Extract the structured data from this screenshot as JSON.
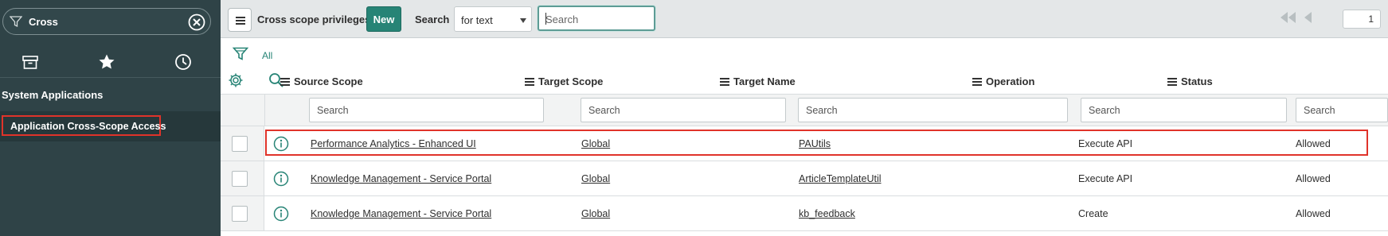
{
  "nav": {
    "filter_value": "Cross",
    "tabs": [
      "archive-icon",
      "star-icon",
      "clock-icon"
    ],
    "section_title": "System Applications",
    "module_label": "Application Cross-Scope Access"
  },
  "header": {
    "title": "Cross scope privileges",
    "new_label": "New",
    "search_label": "Search",
    "search_type": "for text",
    "search_placeholder": "Search",
    "page_number": "1"
  },
  "filter": {
    "all_label": "All"
  },
  "columns": [
    "Source Scope",
    "Target Scope",
    "Target Name",
    "Operation",
    "Status"
  ],
  "column_search_placeholder": "Search",
  "rows": [
    {
      "source_scope": "Performance Analytics - Enhanced UI",
      "target_scope": "Global",
      "target_name": "PAUtils",
      "operation": "Execute API",
      "status": "Allowed"
    },
    {
      "source_scope": "Knowledge Management - Service Portal",
      "target_scope": "Global",
      "target_name": "ArticleTemplateUtil",
      "operation": "Execute API",
      "status": "Allowed"
    },
    {
      "source_scope": "Knowledge Management - Service Portal",
      "target_scope": "Global",
      "target_name": "kb_feedback",
      "operation": "Create",
      "status": "Allowed"
    }
  ],
  "colors": {
    "nav_bg": "#2f4347",
    "accent": "#278476",
    "highlight": "#e0332a",
    "header_bg": "#e4e7e8"
  }
}
